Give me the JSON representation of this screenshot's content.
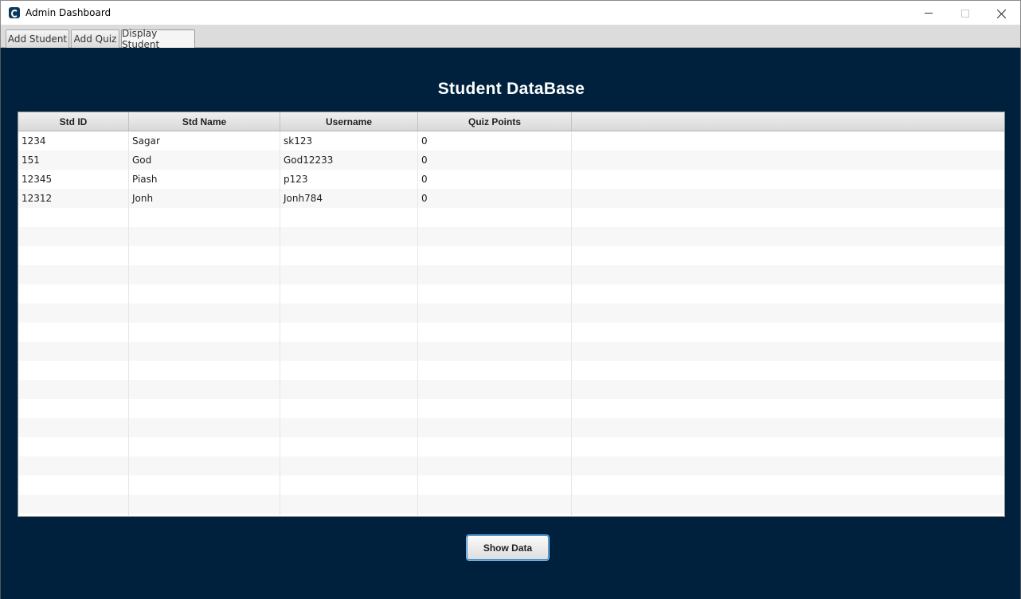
{
  "window": {
    "title": "Admin Dashboard",
    "icon": "app-logo-icon"
  },
  "tabs": [
    {
      "label": "Add Student",
      "selected": false
    },
    {
      "label": "Add Quiz",
      "selected": false
    },
    {
      "label": "Display Student",
      "selected": true
    }
  ],
  "main": {
    "heading": "Student DataBase",
    "button_label": "Show Data",
    "background": "#00213d"
  },
  "table": {
    "columns": [
      "Std ID",
      "Std Name",
      "Username",
      "Quiz Points",
      ""
    ],
    "rows": [
      [
        "1234",
        "Sagar",
        "sk123",
        "0",
        ""
      ],
      [
        "151",
        "God",
        "God12233",
        "0",
        ""
      ],
      [
        "12345",
        "Piash",
        "p123",
        "0",
        ""
      ],
      [
        "12312",
        "Jonh",
        "Jonh784",
        "0",
        ""
      ]
    ]
  }
}
